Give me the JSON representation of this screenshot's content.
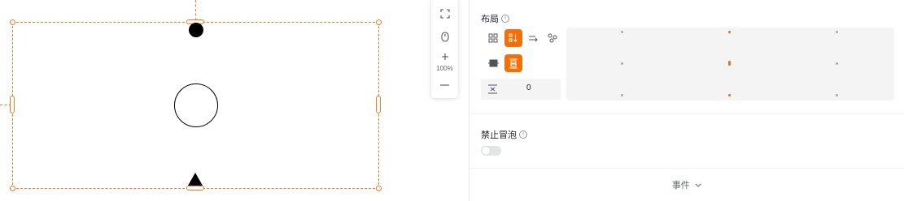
{
  "toolbar": {
    "fit_icon": "fit-screen-icon",
    "mouse_icon": "mouse-icon",
    "zoom_in_icon": "plus-icon",
    "zoom_level": "100%",
    "zoom_out_icon": "minus-icon"
  },
  "canvas": {
    "selection_color": "#f0781e",
    "elements": [
      "filled-circle",
      "outlined-circle",
      "triangle"
    ]
  },
  "layout": {
    "title": "布局",
    "info_icon": "info-icon",
    "direction_buttons": [
      {
        "name": "layout-grid",
        "icon": "grid-icon",
        "active": false
      },
      {
        "name": "layout-vertical",
        "icon": "arrow-down-flow-icon",
        "active": true
      },
      {
        "name": "layout-horizontal",
        "icon": "arrow-right-flow-icon",
        "active": false
      },
      {
        "name": "layout-free",
        "icon": "scatter-icon",
        "active": false
      }
    ],
    "distribution_buttons": [
      {
        "name": "pack-start",
        "icon": "pack-icon",
        "active": false
      },
      {
        "name": "space-between",
        "icon": "space-between-icon",
        "active": true
      }
    ],
    "gap_value": "0",
    "accent_color": "#f66e08",
    "alignment_selected": "center"
  },
  "bubble": {
    "title": "禁止冒泡",
    "toggle_on": false
  },
  "events": {
    "label": "事件",
    "chevron_icon": "chevron-down-icon"
  }
}
